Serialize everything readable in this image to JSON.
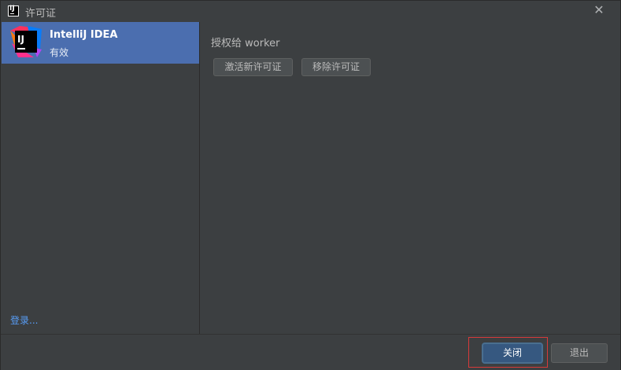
{
  "window": {
    "title": "许可证",
    "app_icon": "intellij-icon",
    "close_icon": "close-icon"
  },
  "sidebar": {
    "product": {
      "name": "IntelliJ IDEA",
      "status": "有效",
      "logo_text": "IJ",
      "selected": true
    },
    "login_link": "登录..."
  },
  "main": {
    "licensed_to": "授权给 worker",
    "buttons": {
      "activate": "激活新许可证",
      "remove": "移除许可证"
    }
  },
  "footer": {
    "close_label": "关闭",
    "exit_label": "退出"
  },
  "colors": {
    "background": "#3c3f41",
    "selection": "#4b6eaf",
    "link": "#589df6",
    "default_button": "#365880",
    "highlight_border": "#d63a3a"
  }
}
